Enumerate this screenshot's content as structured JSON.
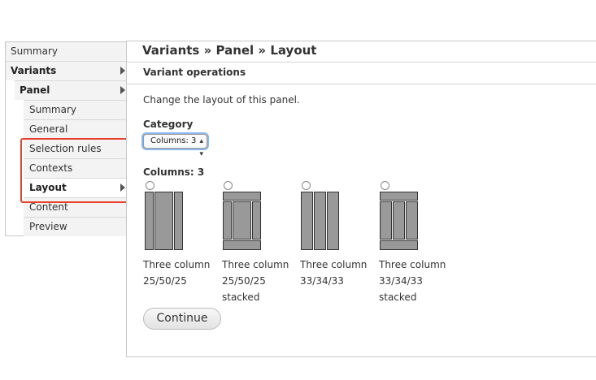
{
  "sidebar": {
    "items": [
      {
        "label": "Summary",
        "arrow": false,
        "bold": false,
        "active": false
      },
      {
        "label": "Variants",
        "arrow": true,
        "bold": true,
        "active": false
      },
      {
        "label": "Panel",
        "arrow": true,
        "bold": true,
        "active": false
      },
      {
        "label": "Summary",
        "arrow": false,
        "bold": false,
        "active": false
      },
      {
        "label": "General",
        "arrow": false,
        "bold": false,
        "active": false
      },
      {
        "label": "Selection rules",
        "arrow": false,
        "bold": false,
        "active": false
      },
      {
        "label": "Contexts",
        "arrow": false,
        "bold": false,
        "active": false
      },
      {
        "label": "Layout",
        "arrow": true,
        "bold": true,
        "active": true
      },
      {
        "label": "Content",
        "arrow": false,
        "bold": false,
        "active": false
      },
      {
        "label": "Preview",
        "arrow": false,
        "bold": false,
        "active": false
      }
    ]
  },
  "main": {
    "title": "Variants » Panel » Layout",
    "subheading": "Variant operations",
    "description": "Change the layout of this panel.",
    "category": {
      "label": "Category",
      "selected": "Columns: 3"
    },
    "section_label": "Columns: 3",
    "layouts": [
      {
        "line1": "Three column",
        "line2": "25/50/25",
        "line3": "",
        "selected": false,
        "icon": "three-column-25-50-25-icon"
      },
      {
        "line1": "Three column",
        "line2": "25/50/25",
        "line3": "stacked",
        "selected": false,
        "icon": "three-column-25-50-25-stacked-icon"
      },
      {
        "line1": "Three column",
        "line2": "33/34/33",
        "line3": "",
        "selected": false,
        "icon": "three-column-33-34-33-icon"
      },
      {
        "line1": "Three column",
        "line2": "33/34/33",
        "line3": "stacked",
        "selected": false,
        "icon": "three-column-33-34-33-stacked-icon"
      }
    ],
    "continue_label": "Continue"
  },
  "colors": {
    "highlight": "#e8402b",
    "focus_ring": "#8db6ef",
    "layout_block": "#999999"
  }
}
